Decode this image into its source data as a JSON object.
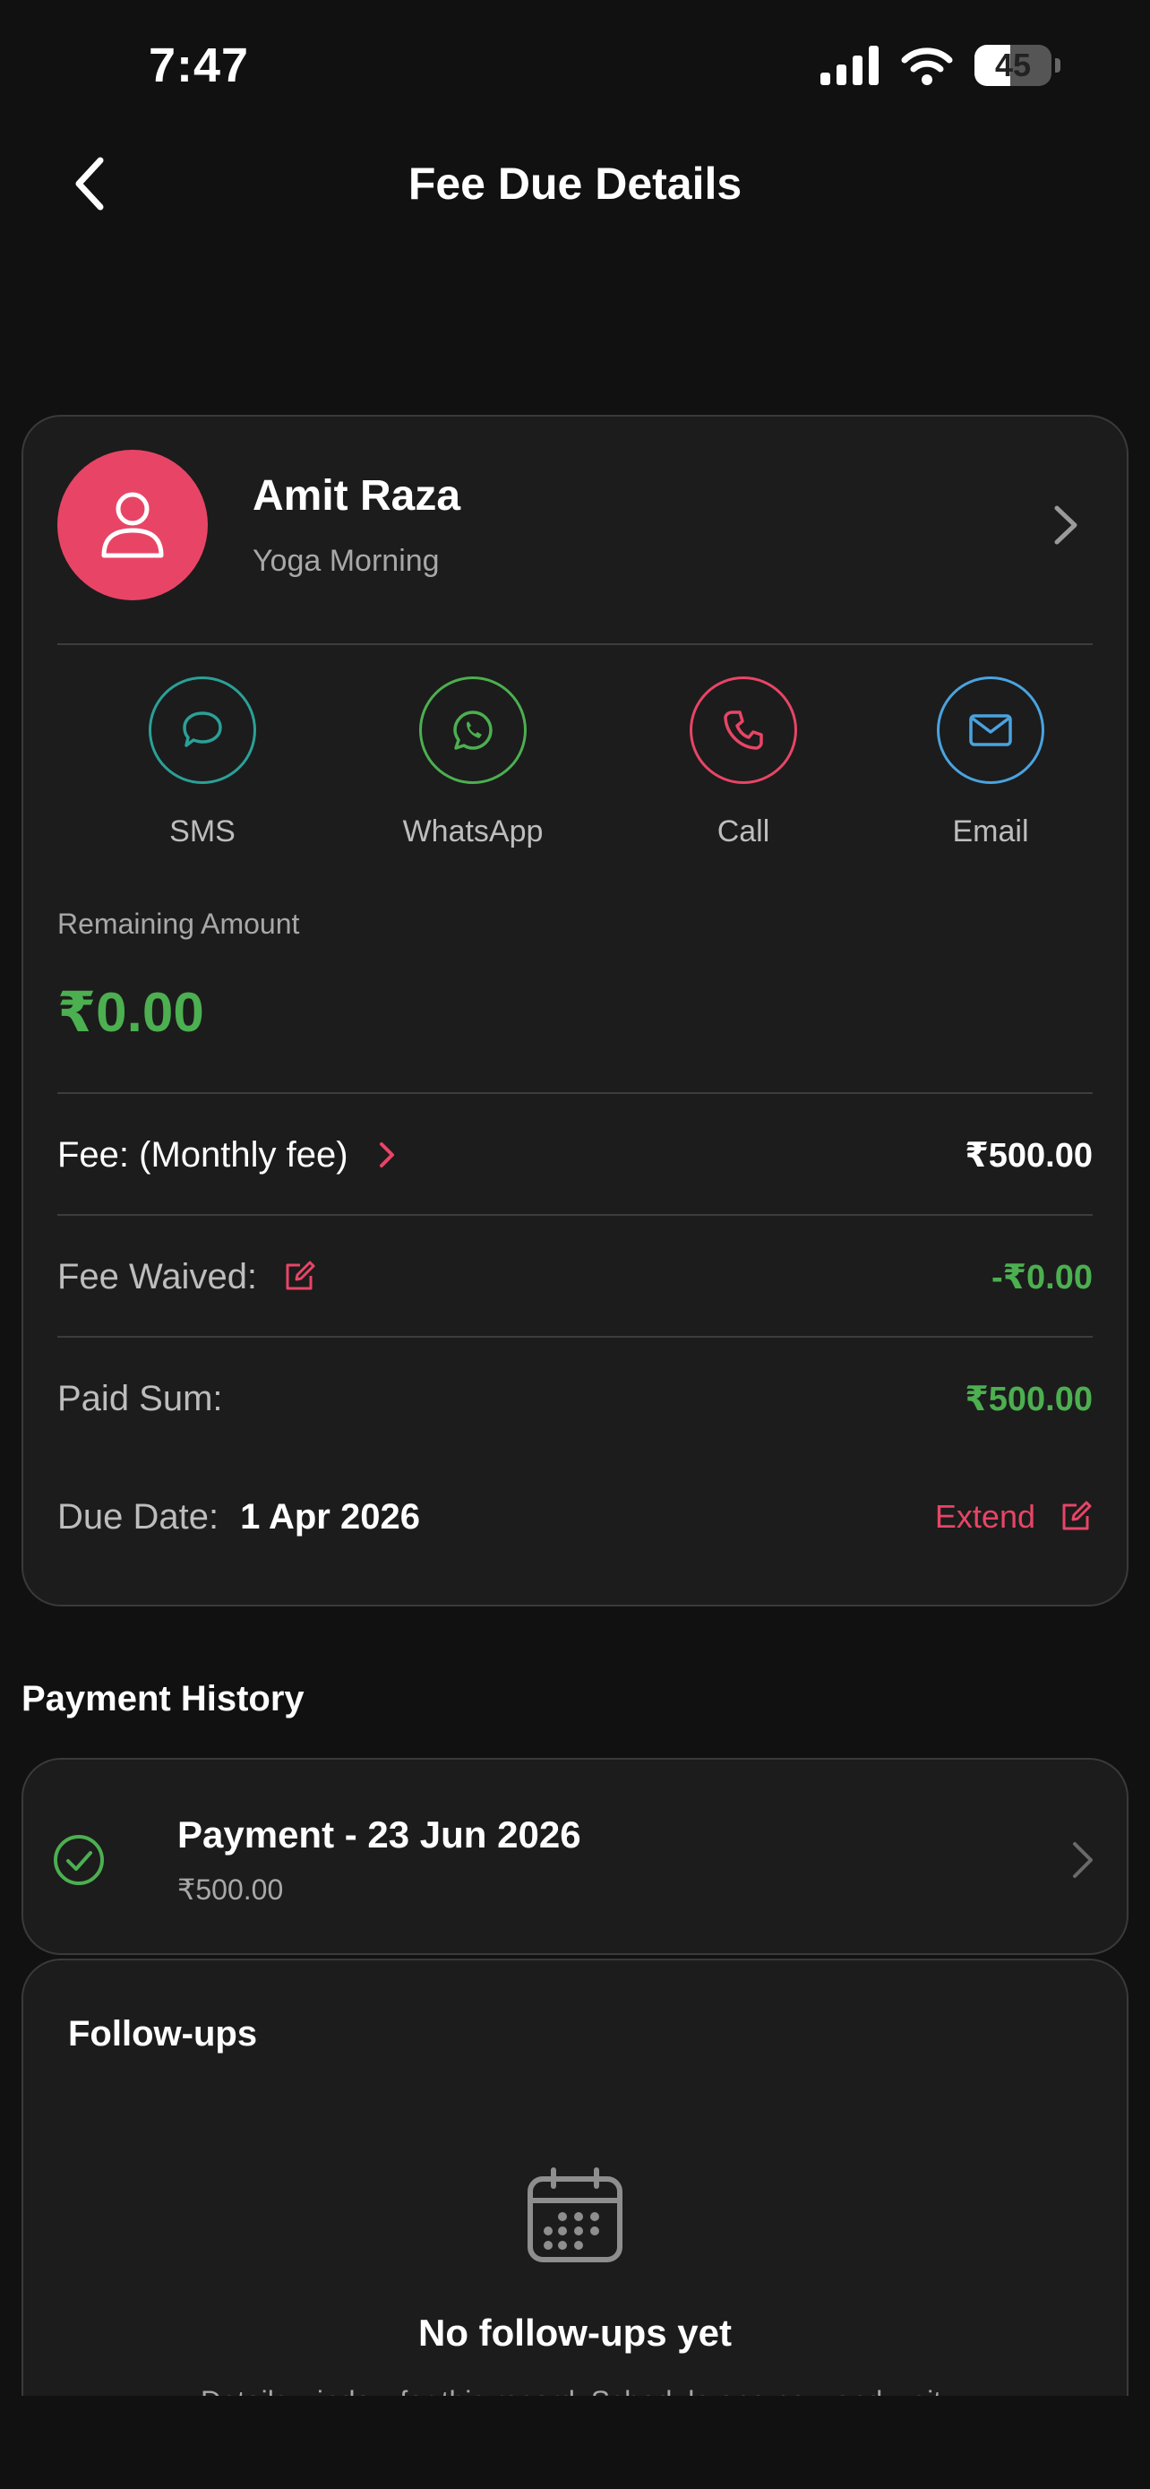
{
  "status_bar": {
    "time": "7:47",
    "battery": "45"
  },
  "header": {
    "title": "Fee Due Details"
  },
  "member": {
    "name": "Amit Raza",
    "plan": "Yoga Morning"
  },
  "contacts": [
    {
      "label": "SMS",
      "color": "#2aa198"
    },
    {
      "label": "WhatsApp",
      "color": "#4caf50"
    },
    {
      "label": "Call",
      "color": "#e84566"
    },
    {
      "label": "Email",
      "color": "#4aa3df"
    }
  ],
  "remaining": {
    "label": "Remaining Amount",
    "value": "₹0.00"
  },
  "fee": {
    "label": "Fee: (Monthly fee)",
    "value": "₹500.00"
  },
  "waived": {
    "label": "Fee Waived:",
    "value": "-₹0.00"
  },
  "paid": {
    "label": "Paid Sum:",
    "value": "₹500.00"
  },
  "due": {
    "label": "Due Date:",
    "value": "1 Apr 2026",
    "extend_label": "Extend"
  },
  "payment_history": {
    "title": "Payment History",
    "items": [
      {
        "title": "Payment - 23 Jun 2026",
        "amount": "₹500.00"
      }
    ]
  },
  "followups": {
    "title": "Follow-ups",
    "empty_title": "No follow-ups yet",
    "empty_sub": "Details window for this record. Schedule one now and wait."
  },
  "colors": {
    "accent": "#e84566",
    "success": "#4caf50",
    "card": "#1c1c1c"
  }
}
